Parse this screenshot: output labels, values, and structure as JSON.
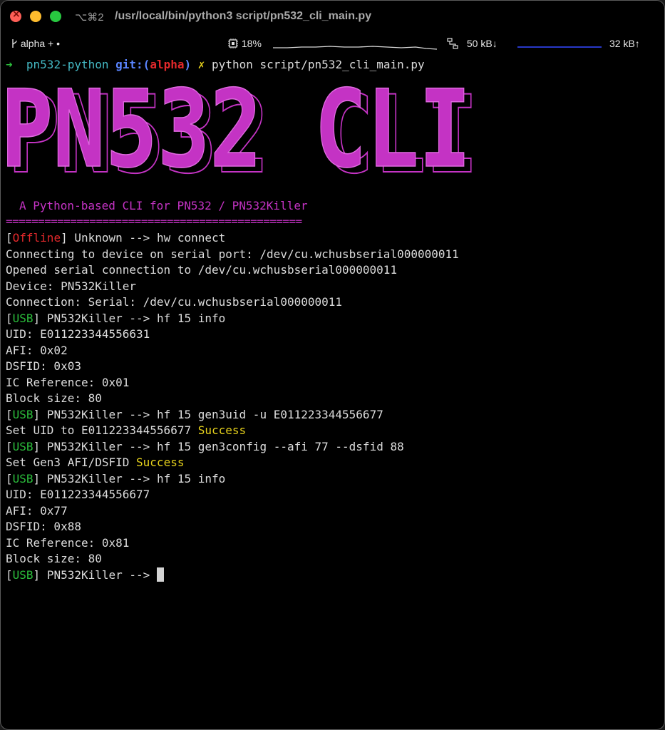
{
  "window": {
    "shortcut": "⌥⌘2",
    "title": "/usr/local/bin/python3 script/pn532_cli_main.py"
  },
  "statusbar": {
    "branch": "alpha + •",
    "cpu": "18%",
    "net_down": "50 kB↓",
    "net_up": "32 kB↑"
  },
  "prompt": {
    "arrow": "➜",
    "dir": "pn532-python",
    "git_label": "git:",
    "paren_open": "(",
    "branch": "alpha",
    "paren_close": ")",
    "dirty": "✗",
    "command": "python script/pn532_cli_main.py"
  },
  "banner": {
    "logo_text": "PN532 CLI",
    "tagline": "A Python-based CLI for PN532 / PN532Killer",
    "rule": "=============================================="
  },
  "output": {
    "l1_open": "[",
    "l1_status": "Offline",
    "l1_close": "]",
    "l1_rest": " Unknown --> hw connect",
    "l2": "Connecting to device on serial port: /dev/cu.wchusbserial000000011",
    "l3": "Opened serial connection to /dev/cu.wchusbserial000000011",
    "l4": "Device: PN532Killer",
    "l5": "Connection: Serial: /dev/cu.wchusbserial000000011",
    "l6_open": "[",
    "l6_status": "USB",
    "l6_close": "]",
    "l6_rest": " PN532Killer --> hf 15 info",
    "l7": "UID: E011223344556631",
    "l8": "AFI: 0x02",
    "l9": "DSFID: 0x03",
    "l10": "IC Reference: 0x01",
    "l11": "Block size: 80",
    "l12_open": "[",
    "l12_status": "USB",
    "l12_close": "]",
    "l12_rest": " PN532Killer --> hf 15 gen3uid -u E011223344556677",
    "l13_text": "Set UID to E011223344556677 ",
    "l13_result": "Success",
    "l14_open": "[",
    "l14_status": "USB",
    "l14_close": "]",
    "l14_rest": " PN532Killer --> hf 15 gen3config --afi 77 --dsfid 88",
    "l15_text": "Set Gen3 AFI/DSFID ",
    "l15_result": "Success",
    "l16_open": "[",
    "l16_status": "USB",
    "l16_close": "]",
    "l16_rest": " PN532Killer --> hf 15 info",
    "l17": "UID: E011223344556677",
    "l18": "AFI: 0x77",
    "l19": "DSFID: 0x88",
    "l20": "IC Reference: 0x81",
    "l21": "Block size: 80",
    "l22_open": "[",
    "l22_status": "USB",
    "l22_close": "]",
    "l22_rest": " PN532Killer --> "
  },
  "colors": {
    "offline": "#e2282b",
    "usb": "#2bbd3b",
    "success": "#e7d21c",
    "banner": "#c433c4"
  }
}
